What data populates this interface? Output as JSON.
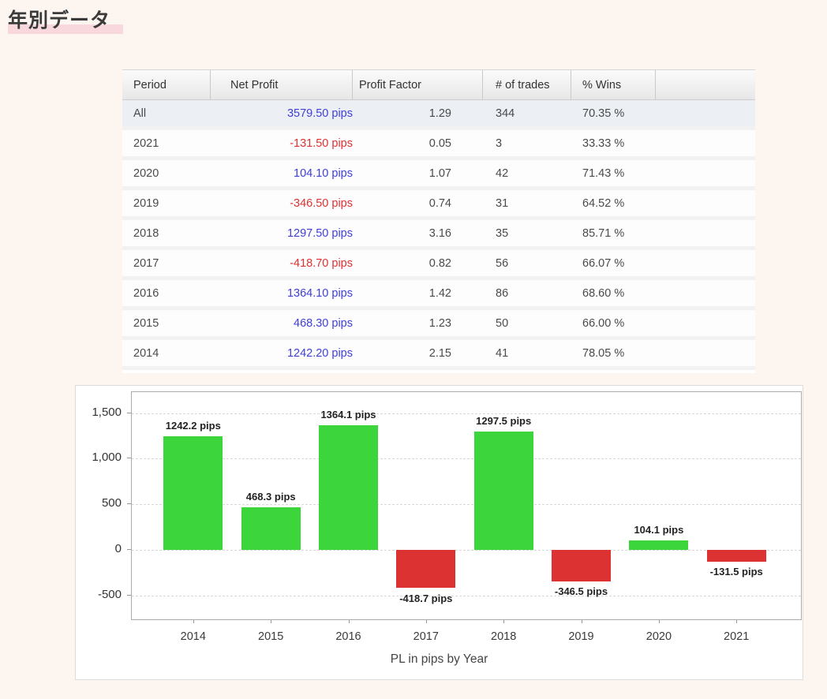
{
  "page": {
    "title": "年別データ",
    "background_color": "#FCF5F0",
    "title_highlight_color": "#F8D8DC"
  },
  "table": {
    "headers": [
      "Period",
      "Net Profit",
      "Profit Factor",
      "# of trades",
      "% Wins",
      ""
    ],
    "rows": [
      {
        "period": "All",
        "net_profit": "3579.50 pips",
        "profit_sign": "positive",
        "profit_factor": "1.29",
        "trades": "344",
        "wins": "70.35 %",
        "highlight": true
      },
      {
        "period": "2021",
        "net_profit": "-131.50 pips",
        "profit_sign": "negative",
        "profit_factor": "0.05",
        "trades": "3",
        "wins": "33.33 %",
        "highlight": false
      },
      {
        "period": "2020",
        "net_profit": "104.10 pips",
        "profit_sign": "positive",
        "profit_factor": "1.07",
        "trades": "42",
        "wins": "71.43 %",
        "highlight": false
      },
      {
        "period": "2019",
        "net_profit": "-346.50 pips",
        "profit_sign": "negative",
        "profit_factor": "0.74",
        "trades": "31",
        "wins": "64.52 %",
        "highlight": false
      },
      {
        "period": "2018",
        "net_profit": "1297.50 pips",
        "profit_sign": "positive",
        "profit_factor": "3.16",
        "trades": "35",
        "wins": "85.71 %",
        "highlight": false
      },
      {
        "period": "2017",
        "net_profit": "-418.70 pips",
        "profit_sign": "negative",
        "profit_factor": "0.82",
        "trades": "56",
        "wins": "66.07 %",
        "highlight": false
      },
      {
        "period": "2016",
        "net_profit": "1364.10 pips",
        "profit_sign": "positive",
        "profit_factor": "1.42",
        "trades": "86",
        "wins": "68.60 %",
        "highlight": false
      },
      {
        "period": "2015",
        "net_profit": "468.30 pips",
        "profit_sign": "positive",
        "profit_factor": "1.23",
        "trades": "50",
        "wins": "66.00 %",
        "highlight": false
      },
      {
        "period": "2014",
        "net_profit": "1242.20 pips",
        "profit_sign": "positive",
        "profit_factor": "2.15",
        "trades": "41",
        "wins": "78.05 %",
        "highlight": false
      }
    ],
    "colors": {
      "profit_positive": "#3E3ED8",
      "profit_negative": "#E03030"
    }
  },
  "chart_data": {
    "type": "bar",
    "title": "PL in pips by Year",
    "xlabel": "",
    "ylabel": "",
    "categories": [
      "2014",
      "2015",
      "2016",
      "2017",
      "2018",
      "2019",
      "2020",
      "2021"
    ],
    "values": [
      1242.2,
      468.3,
      1364.1,
      -418.7,
      1297.5,
      -346.5,
      104.1,
      -131.5
    ],
    "bar_labels": [
      "1242.2 pips",
      "468.3 pips",
      "1364.1 pips",
      "-418.7 pips",
      "1297.5 pips",
      "-346.5 pips",
      "104.1 pips",
      "-131.5 pips"
    ],
    "ylim": [
      -760,
      1730
    ],
    "yticks": [
      {
        "value": 1500,
        "label": "1,500"
      },
      {
        "value": 1000,
        "label": "1,000"
      },
      {
        "value": 500,
        "label": "500"
      },
      {
        "value": 0,
        "label": "0"
      },
      {
        "value": -500,
        "label": "-500"
      }
    ],
    "grid": "horizontal-dashed",
    "legend": "none",
    "colors": {
      "positive_bar": "#3CD53C",
      "negative_bar": "#DC3232"
    }
  }
}
